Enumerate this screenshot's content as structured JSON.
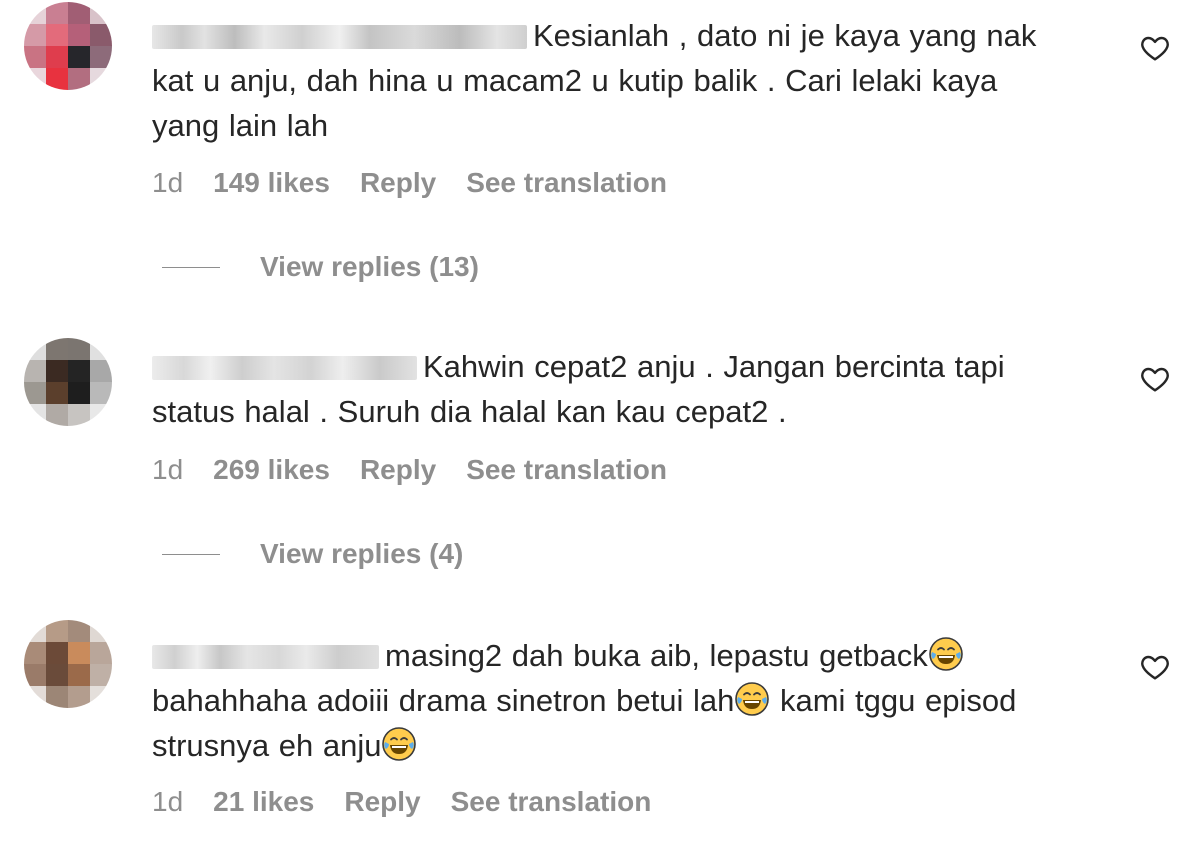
{
  "comments": [
    {
      "text": "Kesianlah , dato ni je kaya yang nak kat u anju, dah hina u macam2 u kutip balik . Cari lelaki kaya yang lain lah",
      "time": "1d",
      "likes": "149 likes",
      "reply_label": "Reply",
      "translate_label": "See translation",
      "view_replies": "View replies (13)"
    },
    {
      "text": "Kahwin cepat2 anju . Jangan bercinta tapi status halal . Suruh dia halal kan kau cepat2 .",
      "time": "1d",
      "likes": "269 likes",
      "reply_label": "Reply",
      "translate_label": "See translation",
      "view_replies": "View replies (4)"
    },
    {
      "text_parts": [
        "masing2 dah buka aib, lepastu getback",
        "bahahhaha adoiii drama sinetron betui lah",
        " kami tggu episod strusnya eh anju"
      ],
      "emoji": "face-with-tears-of-joy",
      "time": "1d",
      "likes": "21 likes",
      "reply_label": "Reply",
      "translate_label": "See translation"
    }
  ],
  "icons": {
    "like": "heart-outline-icon"
  },
  "colors": {
    "text": "#262626",
    "muted": "#8e8e8e"
  }
}
